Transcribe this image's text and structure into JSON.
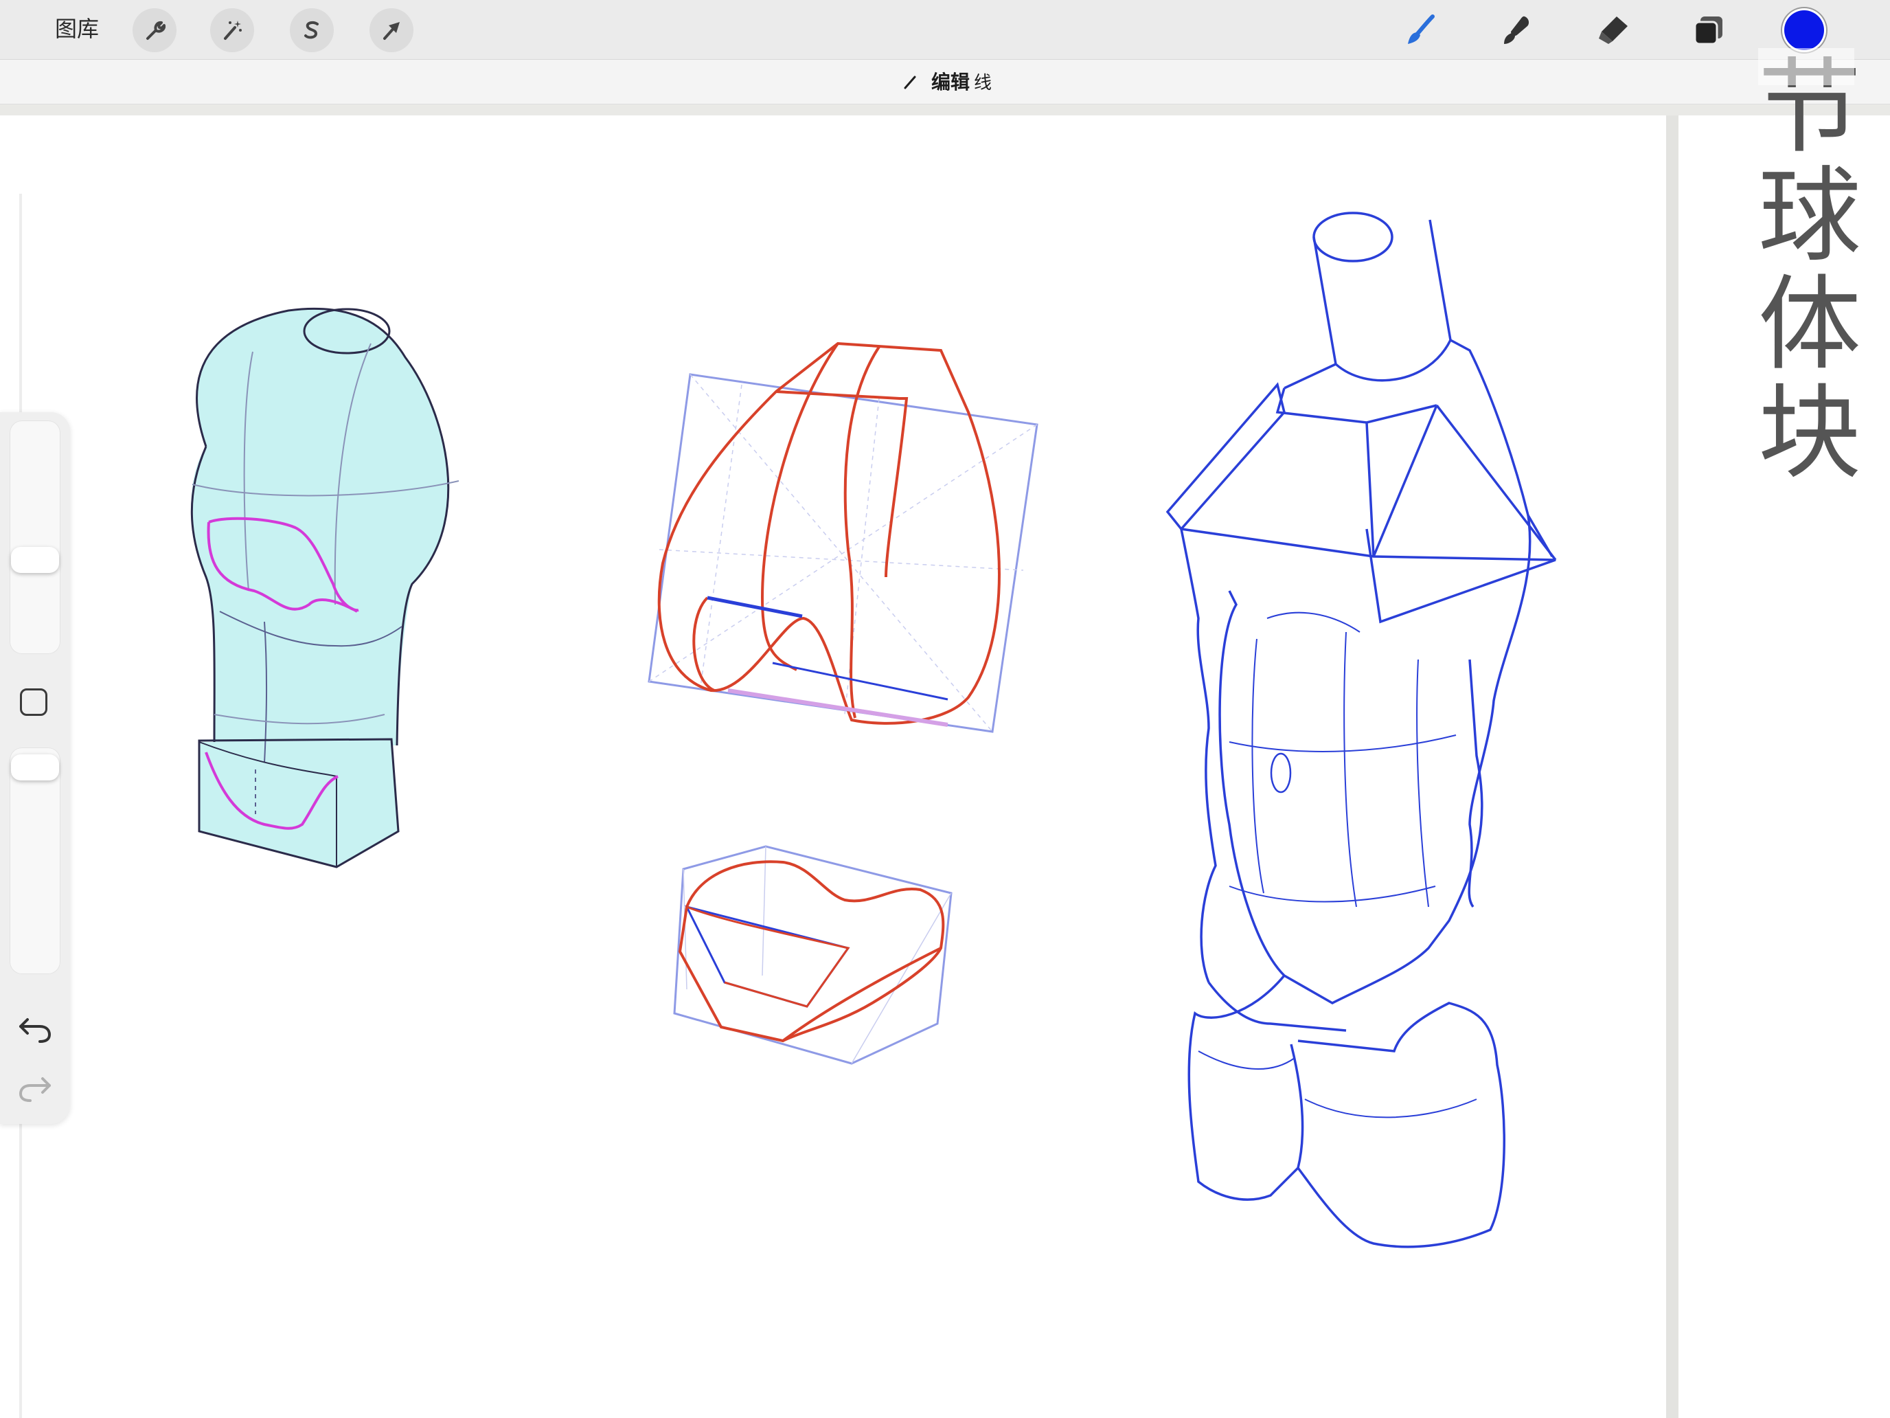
{
  "toolbar": {
    "gallery_label": "图库",
    "actions_icon": "wrench-icon",
    "adjustments_icon": "magic-wand-icon",
    "selection_icon": "selection-s-icon",
    "transform_icon": "arrow-cursor-icon",
    "brush_icon": "brush-icon",
    "smudge_icon": "smudge-icon",
    "eraser_icon": "eraser-icon",
    "layers_icon": "layers-icon",
    "current_color": "#0a18e8"
  },
  "mode_bar": {
    "icon": "pencil-icon",
    "title": "编辑",
    "subtitle": "线"
  },
  "side_text": {
    "chars": [
      "节",
      "球",
      "体",
      "块"
    ]
  },
  "left_panel": {
    "brush_size_icon": "size-slider",
    "modify_button_icon": "square-icon",
    "undo_icon": "undo-arrow-icon",
    "redo_icon": "redo-arrow-icon"
  },
  "colors": {
    "canvas": "#ffffff",
    "toolbar": "#ebebeb",
    "accent_brush": "#2a6fdb",
    "red_lines": "#d8412a",
    "blue_lines": "#2a3fd8",
    "magenta_lines": "#d43ad8",
    "cyan_fill": "#c8f2f2"
  }
}
